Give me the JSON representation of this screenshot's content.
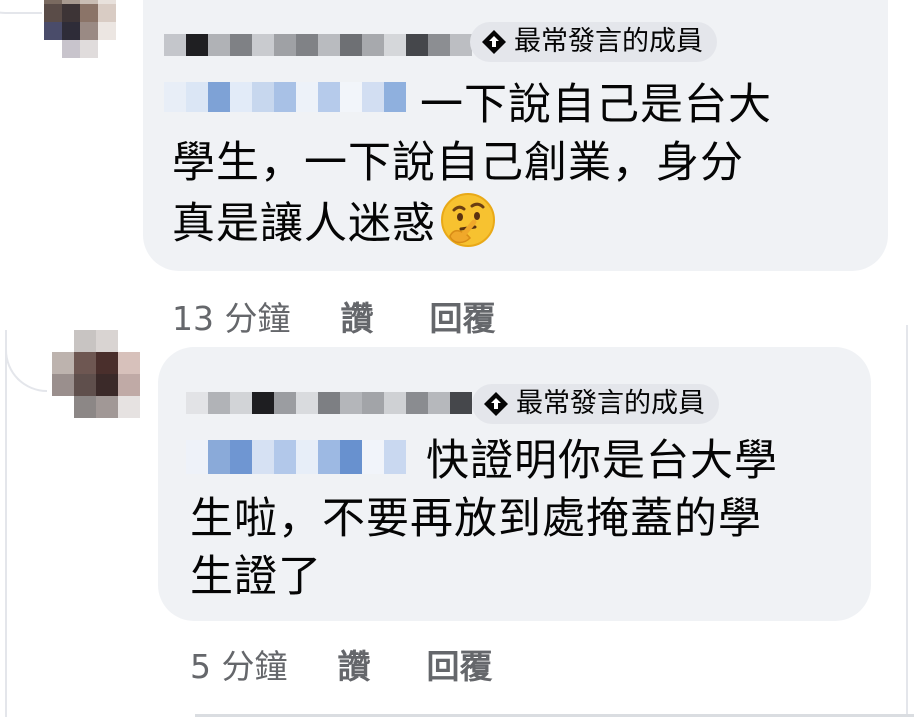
{
  "comments": [
    {
      "badge": "最常發言的成員",
      "text_lines": [
        "一下說自己是台大",
        "學生，一下說自己創業，身分",
        "真是讓人迷惑"
      ],
      "emoji": "thinking-face-emoji",
      "time": "13 分鐘",
      "like_label": "讚",
      "reply_label": "回覆"
    },
    {
      "badge": "最常發言的成員",
      "text_lines": [
        "快證明你是台大學",
        "生啦，不要再放到處掩蓋的學",
        "生證了"
      ],
      "time": "5 分鐘",
      "like_label": "讚",
      "reply_label": "回覆"
    }
  ],
  "colors": {
    "bubble": "#f0f2f5",
    "badge": "#e4e6eb",
    "meta_text": "#65676b",
    "body_text": "#050505"
  }
}
